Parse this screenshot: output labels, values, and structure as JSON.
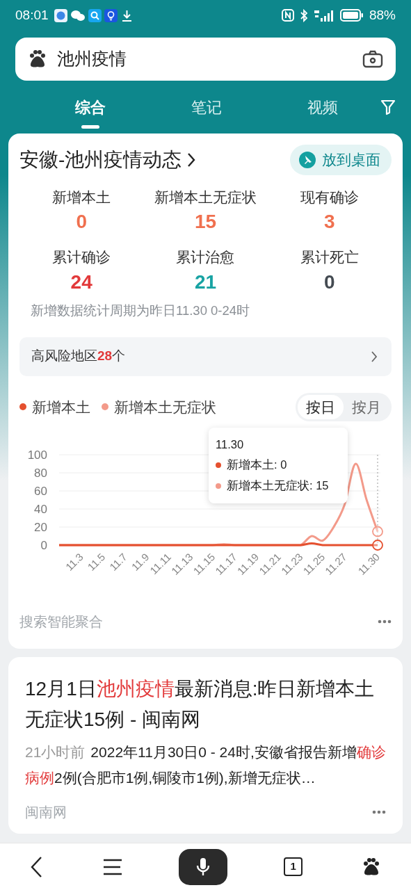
{
  "status_bar": {
    "time": "08:01",
    "battery": "88%"
  },
  "search": {
    "value": "池州疫情"
  },
  "tabs": [
    {
      "label": "综合",
      "selected": true
    },
    {
      "label": "笔记",
      "selected": false
    },
    {
      "label": "视频",
      "selected": false
    }
  ],
  "epidemic_card": {
    "title": "安徽-池州疫情动态",
    "action": "放到桌面",
    "stats": [
      {
        "label": "新增本土",
        "value": "0",
        "color": "#f0704f"
      },
      {
        "label": "新增本土无症状",
        "value": "15",
        "color": "#f0704f"
      },
      {
        "label": "现有确诊",
        "value": "3",
        "color": "#f0704f"
      },
      {
        "label": "累计确诊",
        "value": "24",
        "color": "#e2393a"
      },
      {
        "label": "累计治愈",
        "value": "21",
        "color": "#18a3a3"
      },
      {
        "label": "累计死亡",
        "value": "0",
        "color": "#444b52"
      }
    ],
    "note": "新增数据统计周期为昨日11.30 0-24时",
    "high_risk": "高风险地区**28**个",
    "toggle": [
      {
        "label": "按日",
        "selected": true
      },
      {
        "label": "按月",
        "selected": false
      }
    ],
    "chart_data": {
      "type": "line",
      "categories": [
        null,
        null,
        "11.3",
        null,
        "11.5",
        null,
        "11.7",
        null,
        "11.9",
        null,
        "11.11",
        null,
        "11.13",
        null,
        "11.15",
        null,
        "11.17",
        null,
        "11.19",
        null,
        "11.21",
        null,
        "11.23",
        null,
        "11.25",
        null,
        "11.27",
        null,
        null,
        "11.30"
      ],
      "series": [
        {
          "name": "新增本土",
          "color": "#e5502f",
          "values": [
            0,
            0,
            0,
            0,
            0,
            0,
            0,
            0,
            0,
            0,
            0,
            0,
            0,
            0,
            0,
            0,
            0,
            0,
            0,
            0,
            0,
            0,
            0,
            2,
            0,
            0,
            0,
            0,
            0,
            0
          ]
        },
        {
          "name": "新增本土无症状",
          "color": "#f39a8a",
          "values": [
            0,
            0,
            0,
            0,
            0,
            0,
            0,
            0,
            0,
            0,
            0,
            0,
            0,
            0,
            0,
            1,
            0,
            0,
            0,
            0,
            0,
            0,
            0,
            10,
            5,
            20,
            45,
            90,
            50,
            15
          ]
        }
      ],
      "ylim": [
        0,
        100
      ],
      "yticks": [
        0,
        20,
        40,
        60,
        80,
        100
      ],
      "grid": true
    },
    "tooltip": {
      "title": "11.30",
      "items": [
        "新增本土: 0",
        "新增本土无症状: 15"
      ]
    },
    "footer": "搜索智能聚合"
  },
  "result": {
    "title": "12月1日**池州疫情**最新消息:昨日新增本土无症状15例 - 闽南网",
    "time": "21小时前",
    "snippet": "2022年11月30日0 - 24时,安徽省报告新增**确诊病例**2例(合肥市1例,铜陵市1例),新增无症状…",
    "source": "闽南网"
  },
  "bottom_bar": {
    "tab_count": "1"
  }
}
